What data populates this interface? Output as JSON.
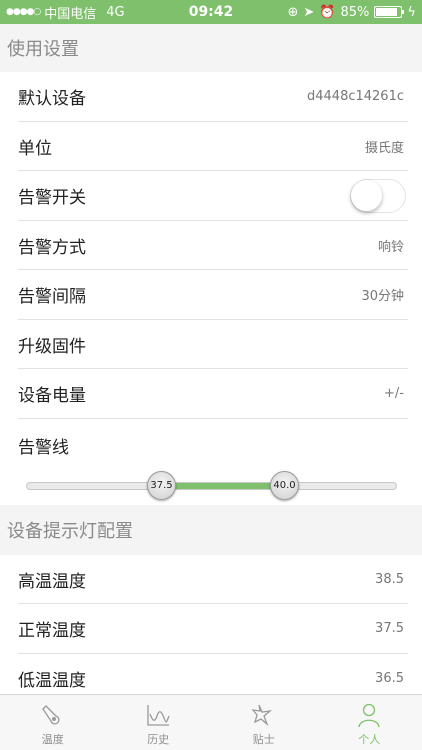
{
  "status_bar": {
    "carrier": "中国电信",
    "network": "4G",
    "time": "09:42",
    "battery_percent": "85%"
  },
  "usage_section": {
    "title": "使用设置",
    "rows": [
      {
        "label": "默认设备",
        "value": "d4448c14261c"
      },
      {
        "label": "单位",
        "value": "摄氏度"
      },
      {
        "label": "告警开关",
        "toggle_on": false
      },
      {
        "label": "告警方式",
        "value": "响铃"
      },
      {
        "label": "告警间隔",
        "value": "30分钟"
      },
      {
        "label": "升级固件",
        "value": ""
      },
      {
        "label": "设备电量",
        "value": "+/-"
      }
    ]
  },
  "alarm_line": {
    "label": "告警线",
    "low": "37.5",
    "high": "40.0"
  },
  "light_section": {
    "title": "设备提示灯配置",
    "rows": [
      {
        "label": "高温温度",
        "value": "38.5"
      },
      {
        "label": "正常温度",
        "value": "37.5"
      },
      {
        "label": "低温温度",
        "value": "36.5"
      }
    ]
  },
  "tabbar": {
    "tabs": [
      {
        "label": "温度",
        "icon": "thermometer-icon"
      },
      {
        "label": "历史",
        "icon": "chart-icon"
      },
      {
        "label": "贴士",
        "icon": "star-icon"
      },
      {
        "label": "个人",
        "icon": "person-icon",
        "active": true
      }
    ]
  },
  "colors": {
    "accent": "#7ec06b",
    "section_text": "#8a8a8a"
  }
}
